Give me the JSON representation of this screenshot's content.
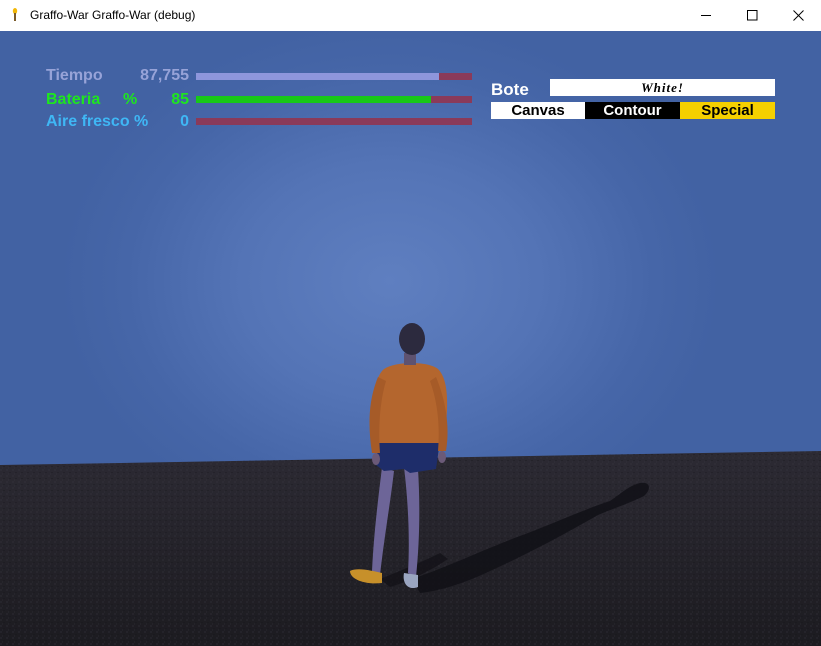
{
  "window": {
    "title": "Graffo-War Graffo-War (debug)"
  },
  "colors": {
    "tiempo_label": "#97a3d8",
    "tiempo_bar": "#8e96dc",
    "bateria_label": "#1ee61e",
    "bateria_bar": "#18c818",
    "aire_label": "#3fb7f5",
    "aire_bar": "#3fb7f5",
    "bar_track": "#8a3a5a",
    "special_bg": "#f5d000"
  },
  "hud": {
    "tiempo": {
      "label": "Tiempo",
      "value": "87,755",
      "fraction": 0.88
    },
    "bateria": {
      "label": "Bateria",
      "unit": "%",
      "value": "85",
      "fraction": 0.85
    },
    "aire": {
      "label": "Aire fresco %",
      "value": "0",
      "fraction": 0
    }
  },
  "bote": {
    "label": "Bote",
    "value": "White!"
  },
  "modes": {
    "canvas": "Canvas",
    "contour": "Contour",
    "special": "Special"
  }
}
